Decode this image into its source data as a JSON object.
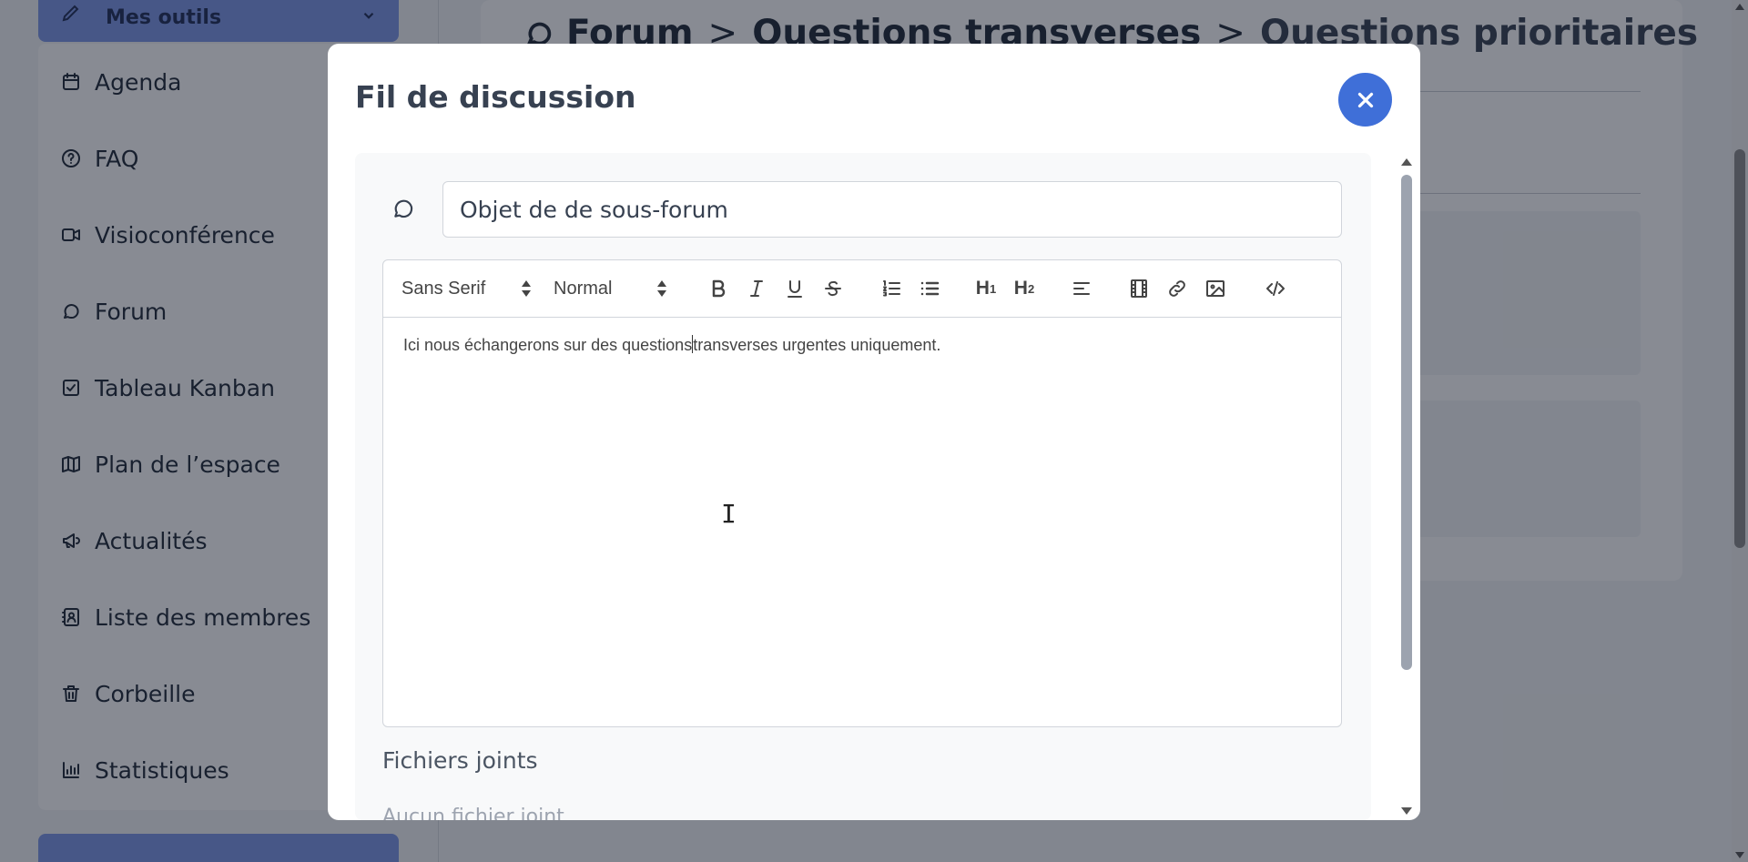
{
  "sidebar": {
    "tools_label": "Mes outils",
    "items": [
      {
        "label": "Agenda",
        "icon": "calendar-icon"
      },
      {
        "label": "FAQ",
        "icon": "help-circle-icon"
      },
      {
        "label": "Visioconférence",
        "icon": "video-icon"
      },
      {
        "label": "Forum",
        "icon": "chat-bubbles-icon"
      },
      {
        "label": "Tableau Kanban",
        "icon": "check-square-icon"
      },
      {
        "label": "Plan de l’espace",
        "icon": "map-icon"
      },
      {
        "label": "Actualités",
        "icon": "megaphone-icon"
      },
      {
        "label": "Liste des membres",
        "icon": "contacts-icon"
      },
      {
        "label": "Corbeille",
        "icon": "trash-icon"
      },
      {
        "label": "Statistiques",
        "icon": "bar-chart-icon"
      }
    ]
  },
  "breadcrumb": {
    "root": "Forum",
    "separator": ">",
    "level1": "Questions transverses",
    "current": "Questions prioritaires"
  },
  "modal": {
    "title": "Fil de discussion",
    "subject": {
      "value": "Objet de de sous-forum",
      "icon": "message-circle-icon"
    },
    "toolbar": {
      "font": "Sans Serif",
      "size": "Normal",
      "h1": "H",
      "h1_sub": "1",
      "h2": "H",
      "h2_sub": "2"
    },
    "content": {
      "before_caret": "Ici nous échangerons sur des questions",
      "after_caret": "transverses urgentes uniquement."
    },
    "attachments": {
      "title": "Fichiers joints",
      "empty": "Aucun fichier joint"
    }
  },
  "colors": {
    "accent": "#3f6fd8",
    "tools_header": "#7c97e6",
    "overlay": "rgba(17,24,39,0.5)"
  }
}
